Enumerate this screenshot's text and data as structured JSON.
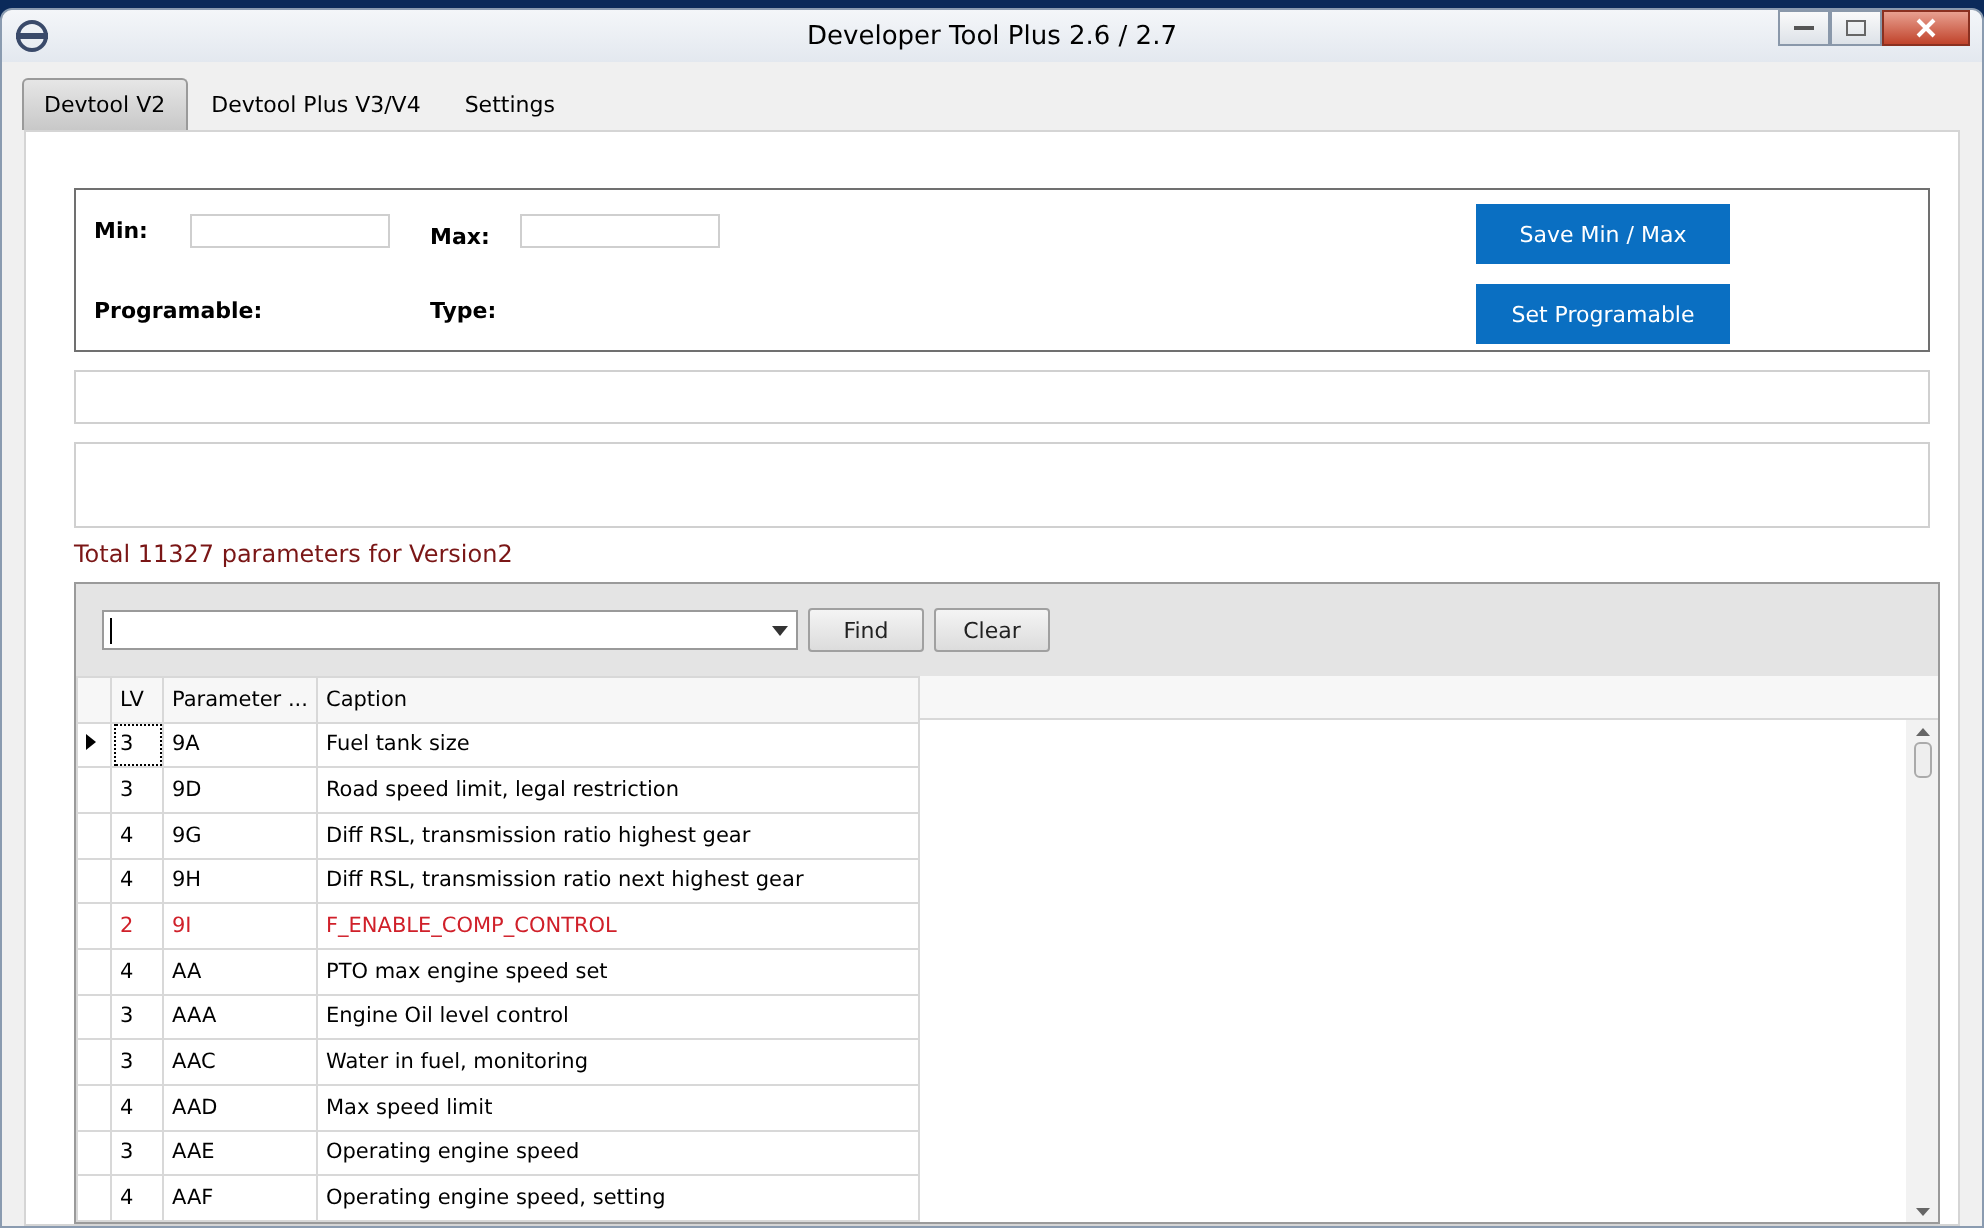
{
  "window": {
    "title": "Developer Tool Plus 2.6 / 2.7"
  },
  "tabs": [
    {
      "label": "Devtool V2",
      "selected": true
    },
    {
      "label": "Devtool Plus V3/V4",
      "selected": false
    },
    {
      "label": "Settings",
      "selected": false
    }
  ],
  "limits": {
    "min_label": "Min:",
    "max_label": "Max:",
    "programable_label": "Programable:",
    "type_label": "Type:",
    "save_button": "Save Min / Max",
    "set_button": "Set Programable"
  },
  "summary": "Total 11327 parameters for Version2",
  "search": {
    "find_button": "Find",
    "clear_button": "Clear"
  },
  "table": {
    "columns": [
      "LV",
      "Parameter ...",
      "Caption"
    ],
    "rows": [
      {
        "cells": [
          "3",
          "9A",
          "Fuel tank size"
        ],
        "selected": true,
        "flagged": false
      },
      {
        "cells": [
          "3",
          "9D",
          "Road speed limit, legal restriction"
        ],
        "selected": false,
        "flagged": false
      },
      {
        "cells": [
          "4",
          "9G",
          "Diff RSL, transmission ratio highest gear"
        ],
        "selected": false,
        "flagged": false
      },
      {
        "cells": [
          "4",
          "9H",
          "Diff RSL, transmission ratio next highest gear"
        ],
        "selected": false,
        "flagged": false
      },
      {
        "cells": [
          "2",
          "9I",
          "F_ENABLE_COMP_CONTROL"
        ],
        "selected": false,
        "flagged": true
      },
      {
        "cells": [
          "4",
          "AA",
          "PTO max engine speed set"
        ],
        "selected": false,
        "flagged": false
      },
      {
        "cells": [
          "3",
          "AAA",
          "Engine Oil level control"
        ],
        "selected": false,
        "flagged": false
      },
      {
        "cells": [
          "3",
          "AAC",
          "Water in fuel, monitoring"
        ],
        "selected": false,
        "flagged": false
      },
      {
        "cells": [
          "4",
          "AAD",
          "Max speed limit"
        ],
        "selected": false,
        "flagged": false
      },
      {
        "cells": [
          "3",
          "AAE",
          "Operating engine speed"
        ],
        "selected": false,
        "flagged": false
      },
      {
        "cells": [
          "4",
          "AAF",
          "Operating engine speed, setting"
        ],
        "selected": false,
        "flagged": false
      }
    ]
  }
}
